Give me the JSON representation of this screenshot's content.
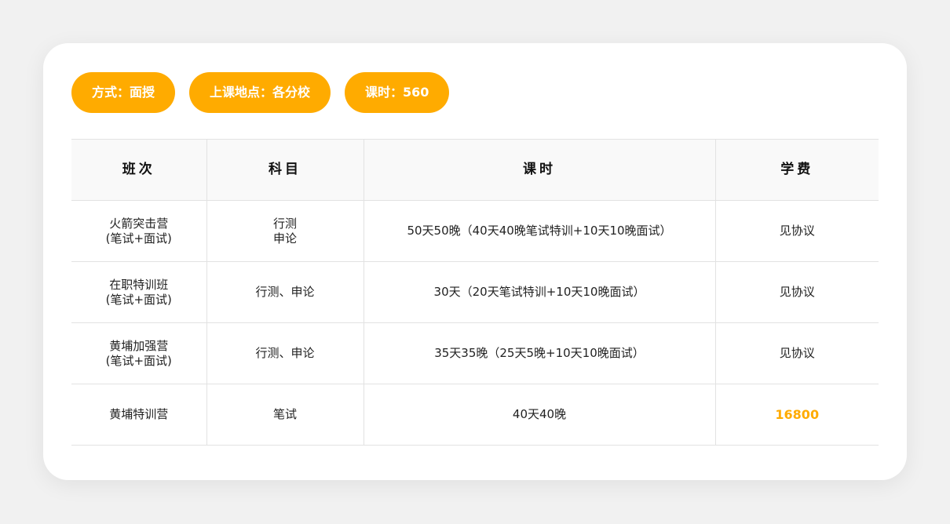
{
  "colors": {
    "accent": "#ffab00",
    "card_bg": "#ffffff",
    "page_bg": "#f1f1f1"
  },
  "tags": [
    {
      "label": "方式：面授"
    },
    {
      "label": "上课地点：各分校"
    },
    {
      "label": "课时：560"
    }
  ],
  "table": {
    "headers": [
      "班次",
      "科目",
      "课时",
      "学费"
    ],
    "rows": [
      {
        "class_name": "火箭突击营",
        "class_sub": "(笔试+面试)",
        "subject_line1": "行测",
        "subject_line2": "申论",
        "hours": "50天50晚（40天40晚笔试特训+10天10晚面试）",
        "fee": "见协议"
      },
      {
        "class_name": "在职特训班",
        "class_sub": "(笔试+面试)",
        "subject_line1": "行测、申论",
        "subject_line2": "",
        "hours": "30天（20天笔试特训+10天10晚面试）",
        "fee": "见协议"
      },
      {
        "class_name": "黄埔加强营",
        "class_sub": "(笔试+面试)",
        "subject_line1": "行测、申论",
        "subject_line2": "",
        "hours": "35天35晚（25天5晚+10天10晚面试）",
        "fee": "见协议"
      },
      {
        "class_name": "黄埔特训营",
        "class_sub": "",
        "subject_line1": "笔试",
        "subject_line2": "",
        "hours": "40天40晚",
        "fee": "16800"
      }
    ]
  }
}
